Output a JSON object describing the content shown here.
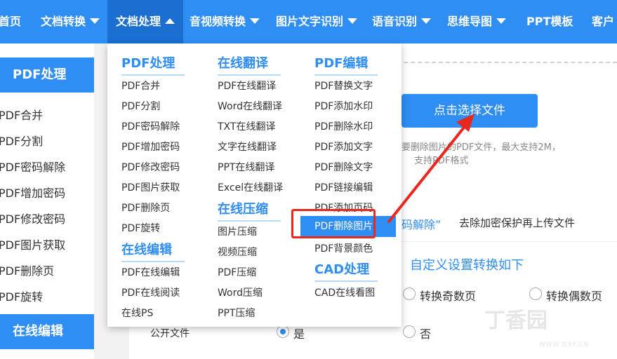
{
  "nav": {
    "items": [
      "首页",
      "文档转换",
      "文档处理",
      "音视频转换",
      "图片文字识别",
      "语音识别",
      "思维导图",
      "PPT模板",
      "客户"
    ]
  },
  "sidebar": {
    "pdf_head": "PDF处理",
    "items": [
      "PDF合并",
      "PDF分割",
      "PDF密码解除",
      "PDF增加密码",
      "PDF修改密码",
      "PDF图片获取",
      "PDF删除页",
      "PDF旋转"
    ],
    "edit_head": "在线编辑"
  },
  "main": {
    "upload_button": "点击选择文件",
    "hint_line1": "要删除图片的PDF文件，最大支持2M，",
    "hint_line2": "支持PDF格式",
    "password_tip_quote": "码解除”",
    "password_tip": "去除加密保护再上传文件",
    "custom_settings": "自定义设置转换如下",
    "odd_pages": "转换奇数页",
    "even_pages": "转换偶数页",
    "public_label": "公开文件",
    "yes": "是",
    "no": "否"
  },
  "dropdown": {
    "col1_head": "PDF处理",
    "col1_items": [
      "PDF合并",
      "PDF分割",
      "PDF密码解除",
      "PDF增加密码",
      "PDF修改密码",
      "PDF图片获取",
      "PDF删除页",
      "PDF旋转"
    ],
    "col1_head2": "在线编辑",
    "col1_items2": [
      "PDF在线编辑",
      "PDF在线阅读",
      "在线PS"
    ],
    "col2_head": "在线翻译",
    "col2_items": [
      "PDF在线翻译",
      "Word在线翻译",
      "TXT在线翻译",
      "文字在线翻译",
      "PPT在线翻译",
      "Excel在线翻译"
    ],
    "col2_head2": "在线压缩",
    "col2_items2": [
      "图片压缩",
      "视频压缩",
      "PDF压缩",
      "Word压缩",
      "PPT压缩"
    ],
    "col3_head": "PDF编辑",
    "col3_items": [
      "PDF替换文字",
      "PDF添加水印",
      "PDF删除水印",
      "PDF添加文字",
      "PDF删除文字",
      "PDF链接编辑",
      "PDF添加页码"
    ],
    "col3_highlight": "PDF删除图片",
    "col3_after": "PDF背景颜色",
    "col3_head2": "CAD处理",
    "col3_items2": [
      "CAD在线看图"
    ]
  },
  "watermark": {
    "text": "丁香园",
    "sub": "WWW.DXY.CN"
  },
  "colors": {
    "brand_blue": "#2f8ef3",
    "active_nav": "#1a6fd1",
    "annotation_red": "#e8281e"
  },
  "icons": [
    "caret-down-icon",
    "caret-up-icon",
    "red-arrow-annotation"
  ]
}
